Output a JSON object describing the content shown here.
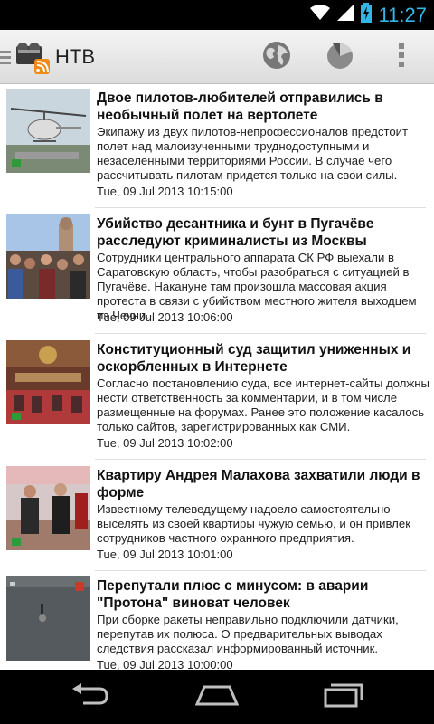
{
  "status_bar": {
    "time": "11:27",
    "icons": [
      "wifi-icon",
      "cell-signal-icon",
      "battery-charging-icon"
    ]
  },
  "action_bar": {
    "title": "НТВ",
    "icons": [
      "app-logo-icon",
      "globe-icon",
      "pie-chart-icon",
      "overflow-menu-icon"
    ]
  },
  "news": [
    {
      "title": "Двое пилотов-любителей отправились в необычный полет на вертолете",
      "description": "Экипажу из двух пилотов-непрофессионалов предстоит полет над малоизученными труднодоступными и незаселенными территориями России. В случае чего рассчитывать пилотам придется только на свои силы.",
      "date": "Tue, 09 Jul 2013 10:15:00"
    },
    {
      "title": "Убийство десантника и бунт в Пугачёве расследуют криминалисты из Москвы",
      "description": "Сотрудники центрального аппарата СК РФ выехали в Саратовскую область, чтобы разобраться с ситуацией в Пугачёве. Накануне там произошла массовая акция протеста в связи с убийством местного жителя выходцем из Чечни.",
      "date": "Tue, 09 Jul 2013 10:06:00"
    },
    {
      "title": "Конституционный суд защитил униженных и оскорбленных в Интернете",
      "description": "Согласно постановлению суда, все интернет-сайты должны нести ответственность за комментарии, и в том числе размещенные на форумах. Ранее это положение касалось только сайтов, зарегистрированных как СМИ.",
      "date": "Tue, 09 Jul 2013 10:02:00"
    },
    {
      "title": "Квартиру Андрея Малахова захватили люди в форме",
      "description": "Известному телеведущему надоело самостоятельно выселять из своей квартиры чужую семью, и он привлек сотрудников частного охранного предприятия.",
      "date": "Tue, 09 Jul 2013 10:01:00"
    },
    {
      "title": "Перепутали плюс с минусом: в аварии \"Протона\" виноват человек",
      "description": "При сборке ракеты неправильно подключили датчики, перепутав их полюса. О предварительных выводах следствия рассказал информированный источник.",
      "date": "Tue, 09 Jul 2013 10:00:00"
    }
  ],
  "nav_bar": {
    "icons": [
      "back-icon",
      "home-icon",
      "recent-apps-icon"
    ]
  }
}
